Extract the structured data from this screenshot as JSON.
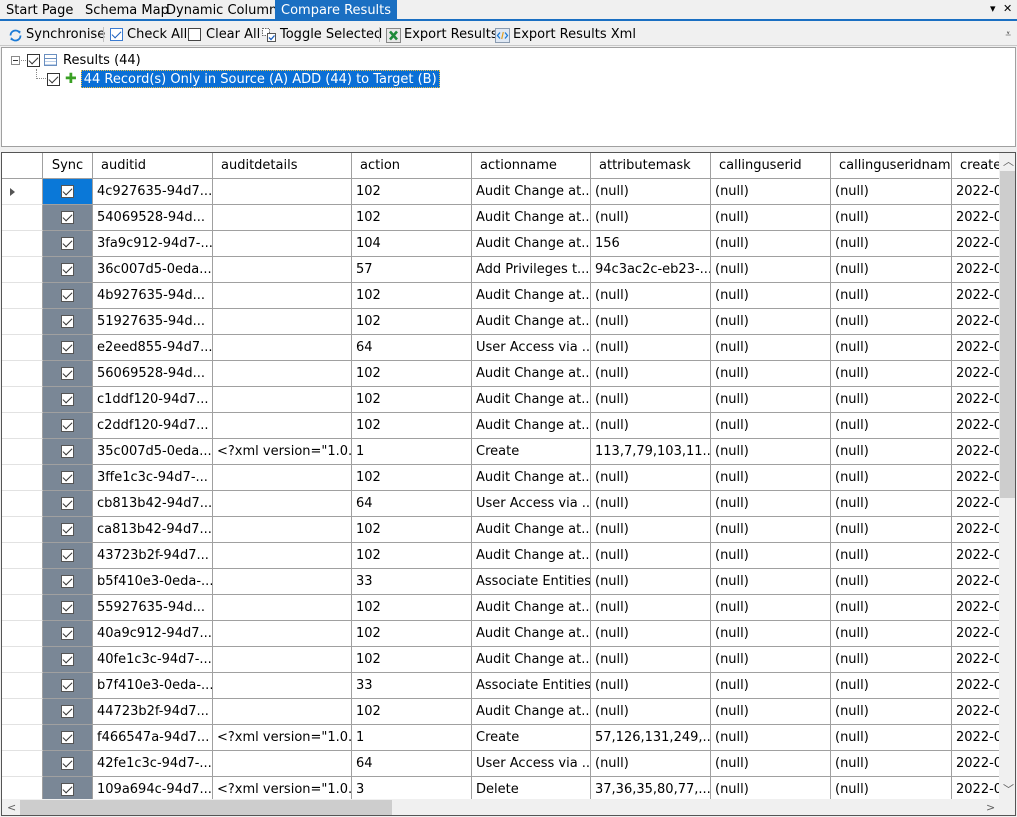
{
  "tabs": [
    {
      "label": "Start Page",
      "active": false
    },
    {
      "label": "Schema Map",
      "active": false
    },
    {
      "label": "Dynamic Columns",
      "active": false
    },
    {
      "label": "Compare Results",
      "active": true
    }
  ],
  "tabstrip_controls": {
    "dropdown": "▾",
    "close": "✕"
  },
  "toolbar": {
    "synchronise": "Synchronise",
    "check_all": "Check All",
    "clear_all": "Clear All",
    "toggle_selected": "Toggle Selected",
    "export_results": "Export Results",
    "export_results_xml": "Export Results Xml",
    "overflow": "⩡"
  },
  "tree": {
    "root_label": "Results (44)",
    "root_checked": true,
    "child_label": "44 Record(s) Only in Source (A) ADD (44) to Target (B)",
    "child_checked": true
  },
  "grid": {
    "columns": [
      "Sync",
      "auditid",
      "auditdetails",
      "action",
      "actionname",
      "attributemask",
      "callinguserid",
      "callinguseridname",
      "create"
    ],
    "rows": [
      {
        "auditid": "4c927635-94d7...",
        "auditdetails": "",
        "action": "102",
        "actionname": "Audit Change at...",
        "attributemask": "(null)",
        "callinguserid": "(null)",
        "callinguseridname": "(null)",
        "created": "2022-0"
      },
      {
        "auditid": "54069528-94d...",
        "auditdetails": "",
        "action": "102",
        "actionname": "Audit Change at...",
        "attributemask": "(null)",
        "callinguserid": "(null)",
        "callinguseridname": "(null)",
        "created": "2022-0"
      },
      {
        "auditid": "3fa9c912-94d7-...",
        "auditdetails": "",
        "action": "104",
        "actionname": "Audit Change at...",
        "attributemask": "156",
        "callinguserid": "(null)",
        "callinguseridname": "(null)",
        "created": "2022-0"
      },
      {
        "auditid": "36c007d5-0eda...",
        "auditdetails": "",
        "action": "57",
        "actionname": "Add Privileges t...",
        "attributemask": "94c3ac2c-eb23-...",
        "callinguserid": "(null)",
        "callinguseridname": "(null)",
        "created": "2022-0"
      },
      {
        "auditid": "4b927635-94d...",
        "auditdetails": "",
        "action": "102",
        "actionname": "Audit Change at...",
        "attributemask": "(null)",
        "callinguserid": "(null)",
        "callinguseridname": "(null)",
        "created": "2022-0"
      },
      {
        "auditid": "51927635-94d...",
        "auditdetails": "",
        "action": "102",
        "actionname": "Audit Change at...",
        "attributemask": "(null)",
        "callinguserid": "(null)",
        "callinguseridname": "(null)",
        "created": "2022-0"
      },
      {
        "auditid": "e2eed855-94d7...",
        "auditdetails": "",
        "action": "64",
        "actionname": "User Access via ...",
        "attributemask": "(null)",
        "callinguserid": "(null)",
        "callinguseridname": "(null)",
        "created": "2022-0"
      },
      {
        "auditid": "56069528-94d...",
        "auditdetails": "",
        "action": "102",
        "actionname": "Audit Change at...",
        "attributemask": "(null)",
        "callinguserid": "(null)",
        "callinguseridname": "(null)",
        "created": "2022-0"
      },
      {
        "auditid": "c1ddf120-94d7...",
        "auditdetails": "",
        "action": "102",
        "actionname": "Audit Change at...",
        "attributemask": "(null)",
        "callinguserid": "(null)",
        "callinguseridname": "(null)",
        "created": "2022-0"
      },
      {
        "auditid": "c2ddf120-94d7...",
        "auditdetails": "",
        "action": "102",
        "actionname": "Audit Change at...",
        "attributemask": "(null)",
        "callinguserid": "(null)",
        "callinguseridname": "(null)",
        "created": "2022-0"
      },
      {
        "auditid": "35c007d5-0eda...",
        "auditdetails": "<?xml version=\"1.0...",
        "action": "1",
        "actionname": "Create",
        "attributemask": "113,7,79,103,11...",
        "callinguserid": "(null)",
        "callinguseridname": "(null)",
        "created": "2022-0"
      },
      {
        "auditid": "3ffe1c3c-94d7-...",
        "auditdetails": "",
        "action": "102",
        "actionname": "Audit Change at...",
        "attributemask": "(null)",
        "callinguserid": "(null)",
        "callinguseridname": "(null)",
        "created": "2022-0"
      },
      {
        "auditid": "cb813b42-94d7...",
        "auditdetails": "",
        "action": "64",
        "actionname": "User Access via ...",
        "attributemask": "(null)",
        "callinguserid": "(null)",
        "callinguseridname": "(null)",
        "created": "2022-0"
      },
      {
        "auditid": "ca813b42-94d7...",
        "auditdetails": "",
        "action": "102",
        "actionname": "Audit Change at...",
        "attributemask": "(null)",
        "callinguserid": "(null)",
        "callinguseridname": "(null)",
        "created": "2022-0"
      },
      {
        "auditid": "43723b2f-94d7...",
        "auditdetails": "",
        "action": "102",
        "actionname": "Audit Change at...",
        "attributemask": "(null)",
        "callinguserid": "(null)",
        "callinguseridname": "(null)",
        "created": "2022-0"
      },
      {
        "auditid": "b5f410e3-0eda-...",
        "auditdetails": "",
        "action": "33",
        "actionname": "Associate Entities",
        "attributemask": "(null)",
        "callinguserid": "(null)",
        "callinguseridname": "(null)",
        "created": "2022-0"
      },
      {
        "auditid": "55927635-94d...",
        "auditdetails": "",
        "action": "102",
        "actionname": "Audit Change at...",
        "attributemask": "(null)",
        "callinguserid": "(null)",
        "callinguseridname": "(null)",
        "created": "2022-0"
      },
      {
        "auditid": "40a9c912-94d7...",
        "auditdetails": "",
        "action": "102",
        "actionname": "Audit Change at...",
        "attributemask": "(null)",
        "callinguserid": "(null)",
        "callinguseridname": "(null)",
        "created": "2022-0"
      },
      {
        "auditid": "40fe1c3c-94d7-...",
        "auditdetails": "",
        "action": "102",
        "actionname": "Audit Change at...",
        "attributemask": "(null)",
        "callinguserid": "(null)",
        "callinguseridname": "(null)",
        "created": "2022-0"
      },
      {
        "auditid": "b7f410e3-0eda-...",
        "auditdetails": "",
        "action": "33",
        "actionname": "Associate Entities",
        "attributemask": "(null)",
        "callinguserid": "(null)",
        "callinguseridname": "(null)",
        "created": "2022-0"
      },
      {
        "auditid": "44723b2f-94d7...",
        "auditdetails": "",
        "action": "102",
        "actionname": "Audit Change at...",
        "attributemask": "(null)",
        "callinguserid": "(null)",
        "callinguseridname": "(null)",
        "created": "2022-0"
      },
      {
        "auditid": "f466547a-94d7...",
        "auditdetails": "<?xml version=\"1.0...",
        "action": "1",
        "actionname": "Create",
        "attributemask": "57,126,131,249,...",
        "callinguserid": "(null)",
        "callinguseridname": "(null)",
        "created": "2022-0"
      },
      {
        "auditid": "42fe1c3c-94d7-...",
        "auditdetails": "",
        "action": "64",
        "actionname": "User Access via ...",
        "attributemask": "(null)",
        "callinguserid": "(null)",
        "callinguseridname": "(null)",
        "created": "2022-0"
      },
      {
        "auditid": "109a694c-94d7...",
        "auditdetails": "<?xml version=\"1.0...",
        "action": "3",
        "actionname": "Delete",
        "attributemask": "37,36,35,80,77,...",
        "callinguserid": "(null)",
        "callinguseridname": "(null)",
        "created": "2022-0"
      }
    ],
    "current_row": 0,
    "all_checked": true
  },
  "colors": {
    "accent": "#1a6fc2",
    "selection": "#0a6fd6",
    "sync_column": "#7a8796",
    "sync_current": "#0a78d8",
    "add_icon": "#3aa024"
  }
}
